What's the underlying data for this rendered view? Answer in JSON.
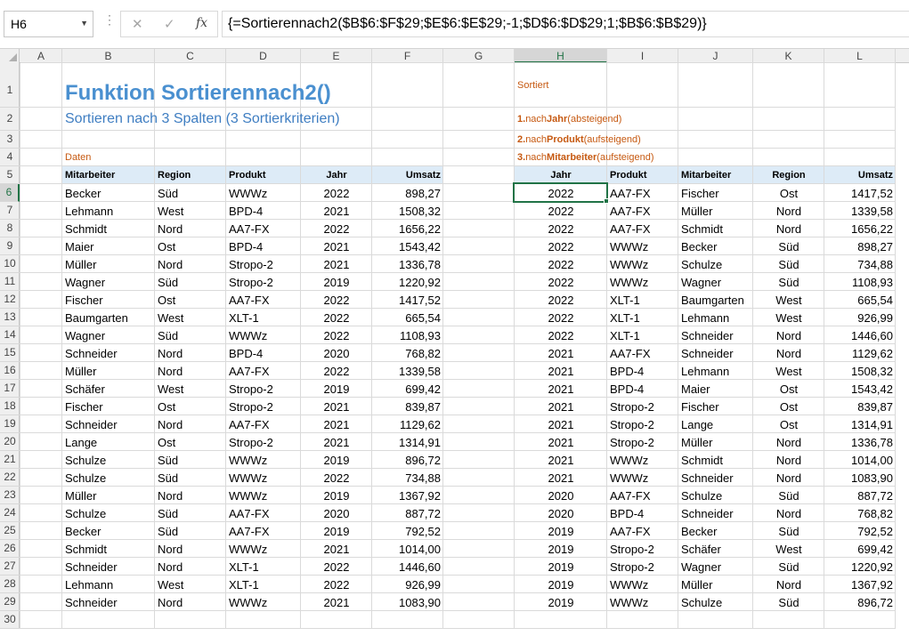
{
  "formula_bar": {
    "name_box": "H6",
    "cancel_icon": "✕",
    "enter_icon": "✓",
    "fx_label": "fx",
    "formula": "{=Sortierennach2($B$6:$F$29;$E$6:$E$29;-1;$D$6:$D$29;1;$B$6:$B$29)}"
  },
  "columns": [
    "A",
    "B",
    "C",
    "D",
    "E",
    "F",
    "G",
    "H",
    "I",
    "J",
    "K",
    "L"
  ],
  "selected_column": "H",
  "rows": [
    "1",
    "2",
    "3",
    "4",
    "5",
    "6",
    "7",
    "8",
    "9",
    "10",
    "11",
    "12",
    "13",
    "14",
    "15",
    "16",
    "17",
    "18",
    "19",
    "20",
    "21",
    "22",
    "23",
    "24",
    "25",
    "26",
    "27",
    "28",
    "29",
    "30"
  ],
  "selected_row": "6",
  "sheet": {
    "title": "Funktion Sortierennach2()",
    "subtitle": "Sortieren nach 3 Spalten (3 Sortierkriterien)",
    "data_label": "Daten",
    "sorted_label": "Sortiert",
    "criteria": [
      {
        "num": "1.",
        "pre": " nach ",
        "key": "Jahr",
        "post": " (absteigend)"
      },
      {
        "num": "2.",
        "pre": " nach ",
        "key": "Produkt",
        "post": " (aufsteigend)"
      },
      {
        "num": "3.",
        "pre": " nach ",
        "key": "Mitarbeiter",
        "post": " (aufsteigend)"
      }
    ],
    "left_headers": [
      "Mitarbeiter",
      "Region",
      "Produkt",
      "Jahr",
      "Umsatz"
    ],
    "right_headers": [
      "Jahr",
      "Produkt",
      "Mitarbeiter",
      "Region",
      "Umsatz"
    ],
    "left_rows": [
      [
        "Becker",
        "Süd",
        "WWWz",
        "2022",
        "898,27"
      ],
      [
        "Lehmann",
        "West",
        "BPD-4",
        "2021",
        "1508,32"
      ],
      [
        "Schmidt",
        "Nord",
        "AA7-FX",
        "2022",
        "1656,22"
      ],
      [
        "Maier",
        "Ost",
        "BPD-4",
        "2021",
        "1543,42"
      ],
      [
        "Müller",
        "Nord",
        "Stropo-2",
        "2021",
        "1336,78"
      ],
      [
        "Wagner",
        "Süd",
        "Stropo-2",
        "2019",
        "1220,92"
      ],
      [
        "Fischer",
        "Ost",
        "AA7-FX",
        "2022",
        "1417,52"
      ],
      [
        "Baumgarten",
        "West",
        "XLT-1",
        "2022",
        "665,54"
      ],
      [
        "Wagner",
        "Süd",
        "WWWz",
        "2022",
        "1108,93"
      ],
      [
        "Schneider",
        "Nord",
        "BPD-4",
        "2020",
        "768,82"
      ],
      [
        "Müller",
        "Nord",
        "AA7-FX",
        "2022",
        "1339,58"
      ],
      [
        "Schäfer",
        "West",
        "Stropo-2",
        "2019",
        "699,42"
      ],
      [
        "Fischer",
        "Ost",
        "Stropo-2",
        "2021",
        "839,87"
      ],
      [
        "Schneider",
        "Nord",
        "AA7-FX",
        "2021",
        "1129,62"
      ],
      [
        "Lange",
        "Ost",
        "Stropo-2",
        "2021",
        "1314,91"
      ],
      [
        "Schulze",
        "Süd",
        "WWWz",
        "2019",
        "896,72"
      ],
      [
        "Schulze",
        "Süd",
        "WWWz",
        "2022",
        "734,88"
      ],
      [
        "Müller",
        "Nord",
        "WWWz",
        "2019",
        "1367,92"
      ],
      [
        "Schulze",
        "Süd",
        "AA7-FX",
        "2020",
        "887,72"
      ],
      [
        "Becker",
        "Süd",
        "AA7-FX",
        "2019",
        "792,52"
      ],
      [
        "Schmidt",
        "Nord",
        "WWWz",
        "2021",
        "1014,00"
      ],
      [
        "Schneider",
        "Nord",
        "XLT-1",
        "2022",
        "1446,60"
      ],
      [
        "Lehmann",
        "West",
        "XLT-1",
        "2022",
        "926,99"
      ],
      [
        "Schneider",
        "Nord",
        "WWWz",
        "2021",
        "1083,90"
      ]
    ],
    "right_rows": [
      [
        "2022",
        "AA7-FX",
        "Fischer",
        "Ost",
        "1417,52"
      ],
      [
        "2022",
        "AA7-FX",
        "Müller",
        "Nord",
        "1339,58"
      ],
      [
        "2022",
        "AA7-FX",
        "Schmidt",
        "Nord",
        "1656,22"
      ],
      [
        "2022",
        "WWWz",
        "Becker",
        "Süd",
        "898,27"
      ],
      [
        "2022",
        "WWWz",
        "Schulze",
        "Süd",
        "734,88"
      ],
      [
        "2022",
        "WWWz",
        "Wagner",
        "Süd",
        "1108,93"
      ],
      [
        "2022",
        "XLT-1",
        "Baumgarten",
        "West",
        "665,54"
      ],
      [
        "2022",
        "XLT-1",
        "Lehmann",
        "West",
        "926,99"
      ],
      [
        "2022",
        "XLT-1",
        "Schneider",
        "Nord",
        "1446,60"
      ],
      [
        "2021",
        "AA7-FX",
        "Schneider",
        "Nord",
        "1129,62"
      ],
      [
        "2021",
        "BPD-4",
        "Lehmann",
        "West",
        "1508,32"
      ],
      [
        "2021",
        "BPD-4",
        "Maier",
        "Ost",
        "1543,42"
      ],
      [
        "2021",
        "Stropo-2",
        "Fischer",
        "Ost",
        "839,87"
      ],
      [
        "2021",
        "Stropo-2",
        "Lange",
        "Ost",
        "1314,91"
      ],
      [
        "2021",
        "Stropo-2",
        "Müller",
        "Nord",
        "1336,78"
      ],
      [
        "2021",
        "WWWz",
        "Schmidt",
        "Nord",
        "1014,00"
      ],
      [
        "2021",
        "WWWz",
        "Schneider",
        "Nord",
        "1083,90"
      ],
      [
        "2020",
        "AA7-FX",
        "Schulze",
        "Süd",
        "887,72"
      ],
      [
        "2020",
        "BPD-4",
        "Schneider",
        "Nord",
        "768,82"
      ],
      [
        "2019",
        "AA7-FX",
        "Becker",
        "Süd",
        "792,52"
      ],
      [
        "2019",
        "Stropo-2",
        "Schäfer",
        "West",
        "699,42"
      ],
      [
        "2019",
        "Stropo-2",
        "Wagner",
        "Süd",
        "1220,92"
      ],
      [
        "2019",
        "WWWz",
        "Müller",
        "Nord",
        "1367,92"
      ],
      [
        "2019",
        "WWWz",
        "Schulze",
        "Süd",
        "896,72"
      ]
    ]
  },
  "colors": {
    "title": "#4a90d0",
    "accent_orange": "#c65911",
    "header_fill": "#ddebf7",
    "selection": "#217346"
  }
}
